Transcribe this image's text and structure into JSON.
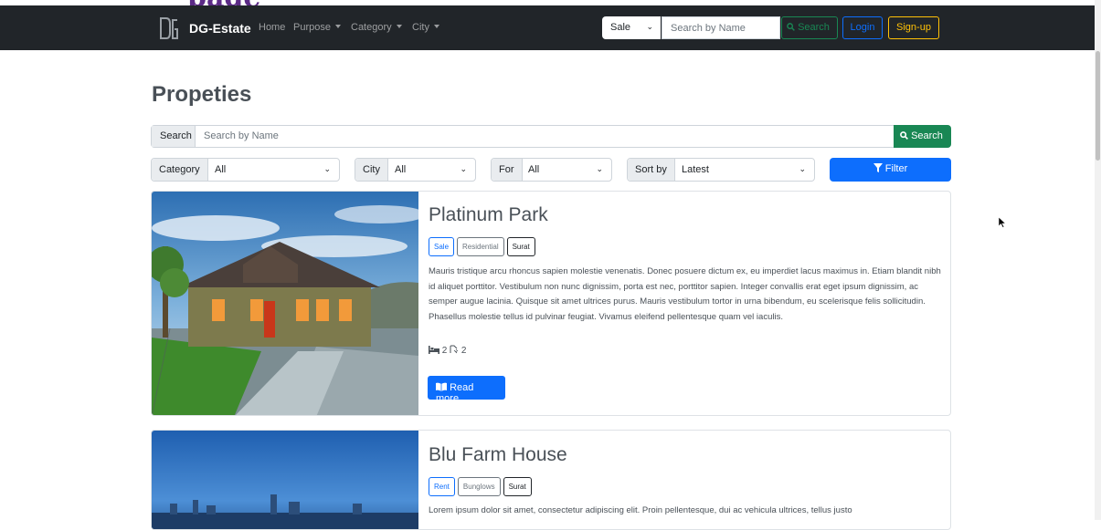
{
  "navbar": {
    "brand": "DG-Estate",
    "links": [
      "Home",
      "Purpose",
      "Category",
      "City"
    ],
    "select_value": "Sale",
    "search_placeholder": "Search by Name",
    "search_button": "Search",
    "login": "Login",
    "signup": "Sign-up"
  },
  "page_title": "Propeties",
  "search": {
    "addon": "Search",
    "placeholder": "Search by Name",
    "button": "Search"
  },
  "filters": {
    "category_label": "Category",
    "category_value": "All",
    "city_label": "City",
    "city_value": "All",
    "for_label": "For",
    "for_value": "All",
    "sort_label": "Sort by",
    "sort_value": "Latest",
    "button": "Filter"
  },
  "properties": [
    {
      "title": "Platinum Park",
      "badges": [
        "Sale",
        "Residential",
        "Surat"
      ],
      "description": "Mauris tristique arcu rhoncus sapien molestie venenatis. Donec posuere dictum ex, eu imperdiet lacus maximus in. Etiam blandit nibh id aliquet porttitor. Vestibulum non nunc dignissim, porta est nec, porttitor sapien. Integer convallis erat eget ipsum dignissim, ac semper augue lacinia. Quisque sit amet ultrices purus. Mauris vestibulum tortor in urna bibendum, eu scelerisque felis sollicitudin. Phasellus molestie tellus id pulvinar feugiat. Vivamus eleifend pellentesque quam vel iaculis.",
      "beds": "2",
      "baths": "2",
      "button": "Read more"
    },
    {
      "title": "Blu Farm House",
      "badges": [
        "Rent",
        "Bunglows",
        "Surat"
      ],
      "description": "Lorem ipsum dolor sit amet, consectetur adipiscing elit. Proin pellentesque, dui ac vehicula ultrices, tellus justo"
    }
  ],
  "colors": {
    "navbar_bg": "#212529",
    "primary": "#0d6efd",
    "success": "#198754",
    "warning": "#ffc107"
  }
}
